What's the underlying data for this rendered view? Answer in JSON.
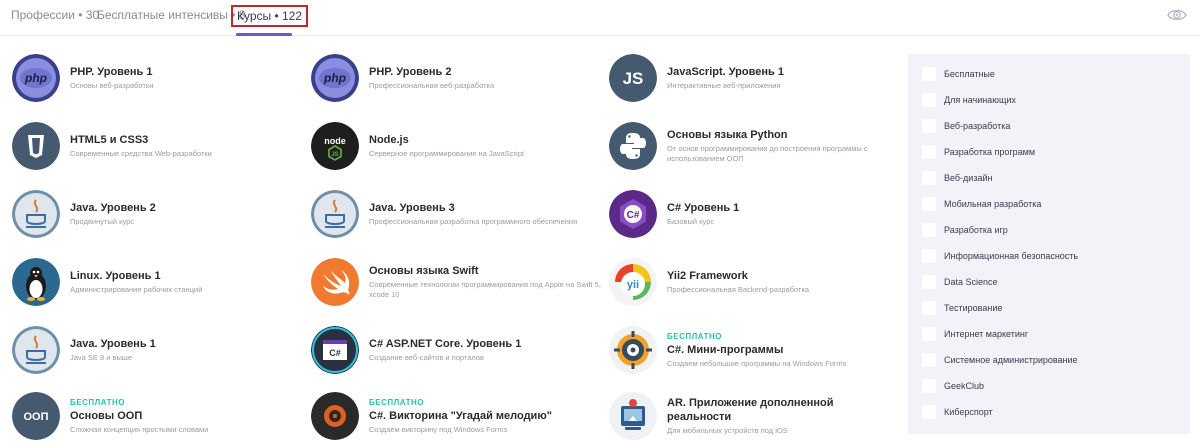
{
  "tabs": [
    {
      "label": "Профессии • 30"
    },
    {
      "label": "Бесплатные интенсивы • 8"
    },
    {
      "label": "Курсы • 122",
      "active": true
    }
  ],
  "courses": {
    "col1": [
      {
        "title": "PHP. Уровень 1",
        "desc": "Основы веб-разработки",
        "icon": "php-icon"
      },
      {
        "title": "HTML5 и CSS3",
        "desc": "Современные средства Web-разработки",
        "icon": "html5-shield-icon"
      },
      {
        "title": "Java. Уровень 2",
        "desc": "Продвинутый курс",
        "icon": "java-cup-icon"
      },
      {
        "title": "Linux. Уровень 1",
        "desc": "Администрирование рабочих станций",
        "icon": "linux-penguin-icon"
      },
      {
        "title": "Java. Уровень 1",
        "desc": "Java SE 8 и выше",
        "icon": "java-cup-icon"
      },
      {
        "badge": "БЕСПЛАТНО",
        "title": "Основы ООП",
        "desc": "Сложная концепция простыми словами",
        "icon": "oop-icon",
        "icon_text": "ООП"
      }
    ],
    "col2": [
      {
        "title": "PHP. Уровень 2",
        "desc": "Профессиональная веб-разработка",
        "icon": "php-icon"
      },
      {
        "title": "Node.js",
        "desc": "Серверное программирование на JavaScript",
        "icon": "nodejs-icon",
        "icon_text": "node"
      },
      {
        "title": "Java. Уровень 3",
        "desc": "Профессиональная разработка программного обеспечения",
        "icon": "java-cup-icon"
      },
      {
        "title": "Основы языка Swift",
        "desc": "Современные технологии программирования под Apple на Swift 5, xcode 10",
        "icon": "swift-icon"
      },
      {
        "title": "C# ASP.NET Core. Уровень 1",
        "desc": "Создание веб-сайтов и порталов",
        "icon": "csharp-window-icon",
        "icon_text": "C#"
      },
      {
        "badge": "БЕСПЛАТНО",
        "title": "C#. Викторина \"Угадай мелодию\"",
        "desc": "Создаем викторину под Windows Forms",
        "icon": "melody-quiz-icon"
      }
    ],
    "col3": [
      {
        "title": "JavaScript. Уровень 1",
        "desc": "Интерактивные веб-приложения",
        "icon": "javascript-icon",
        "icon_text": "JS"
      },
      {
        "title": "Основы языка Python",
        "desc": "От основ программирования до построения программы с использованием ООП",
        "icon": "python-icon"
      },
      {
        "title": "C# Уровень 1",
        "desc": "Базовый курс",
        "icon": "csharp-hexagon-icon",
        "icon_text": "C#"
      },
      {
        "title": "Yii2 Framework",
        "desc": "Профессиональная Backend-разработка",
        "icon": "yii-icon",
        "icon_text": "yii"
      },
      {
        "badge": "БЕСПЛАТНО",
        "title": "C#. Мини-программы",
        "desc": "Создаем небольшие программы на Windows Forms",
        "icon": "gear-target-icon"
      },
      {
        "title": "AR. Приложение дополненной реальности",
        "desc": "Для мобильных устройств под iOS",
        "icon": "ar-app-icon"
      }
    ]
  },
  "filters": [
    "Бесплатные",
    "Для начинающих",
    "Веб-разработка",
    "Разработка программ",
    "Веб-дизайн",
    "Мобильная разработка",
    "Разработка игр",
    "Информационная безопасность",
    "Data Science",
    "Тестирование",
    "Интернет маркетинг",
    "Системное администрирование",
    "GeekClub",
    "Киберспорт"
  ],
  "colors": {
    "accent": "#6a5ad0",
    "highlight_border": "#c0262d",
    "free_badge": "#2ac2a0",
    "filter_panel_bg": "#f2f2f9"
  }
}
